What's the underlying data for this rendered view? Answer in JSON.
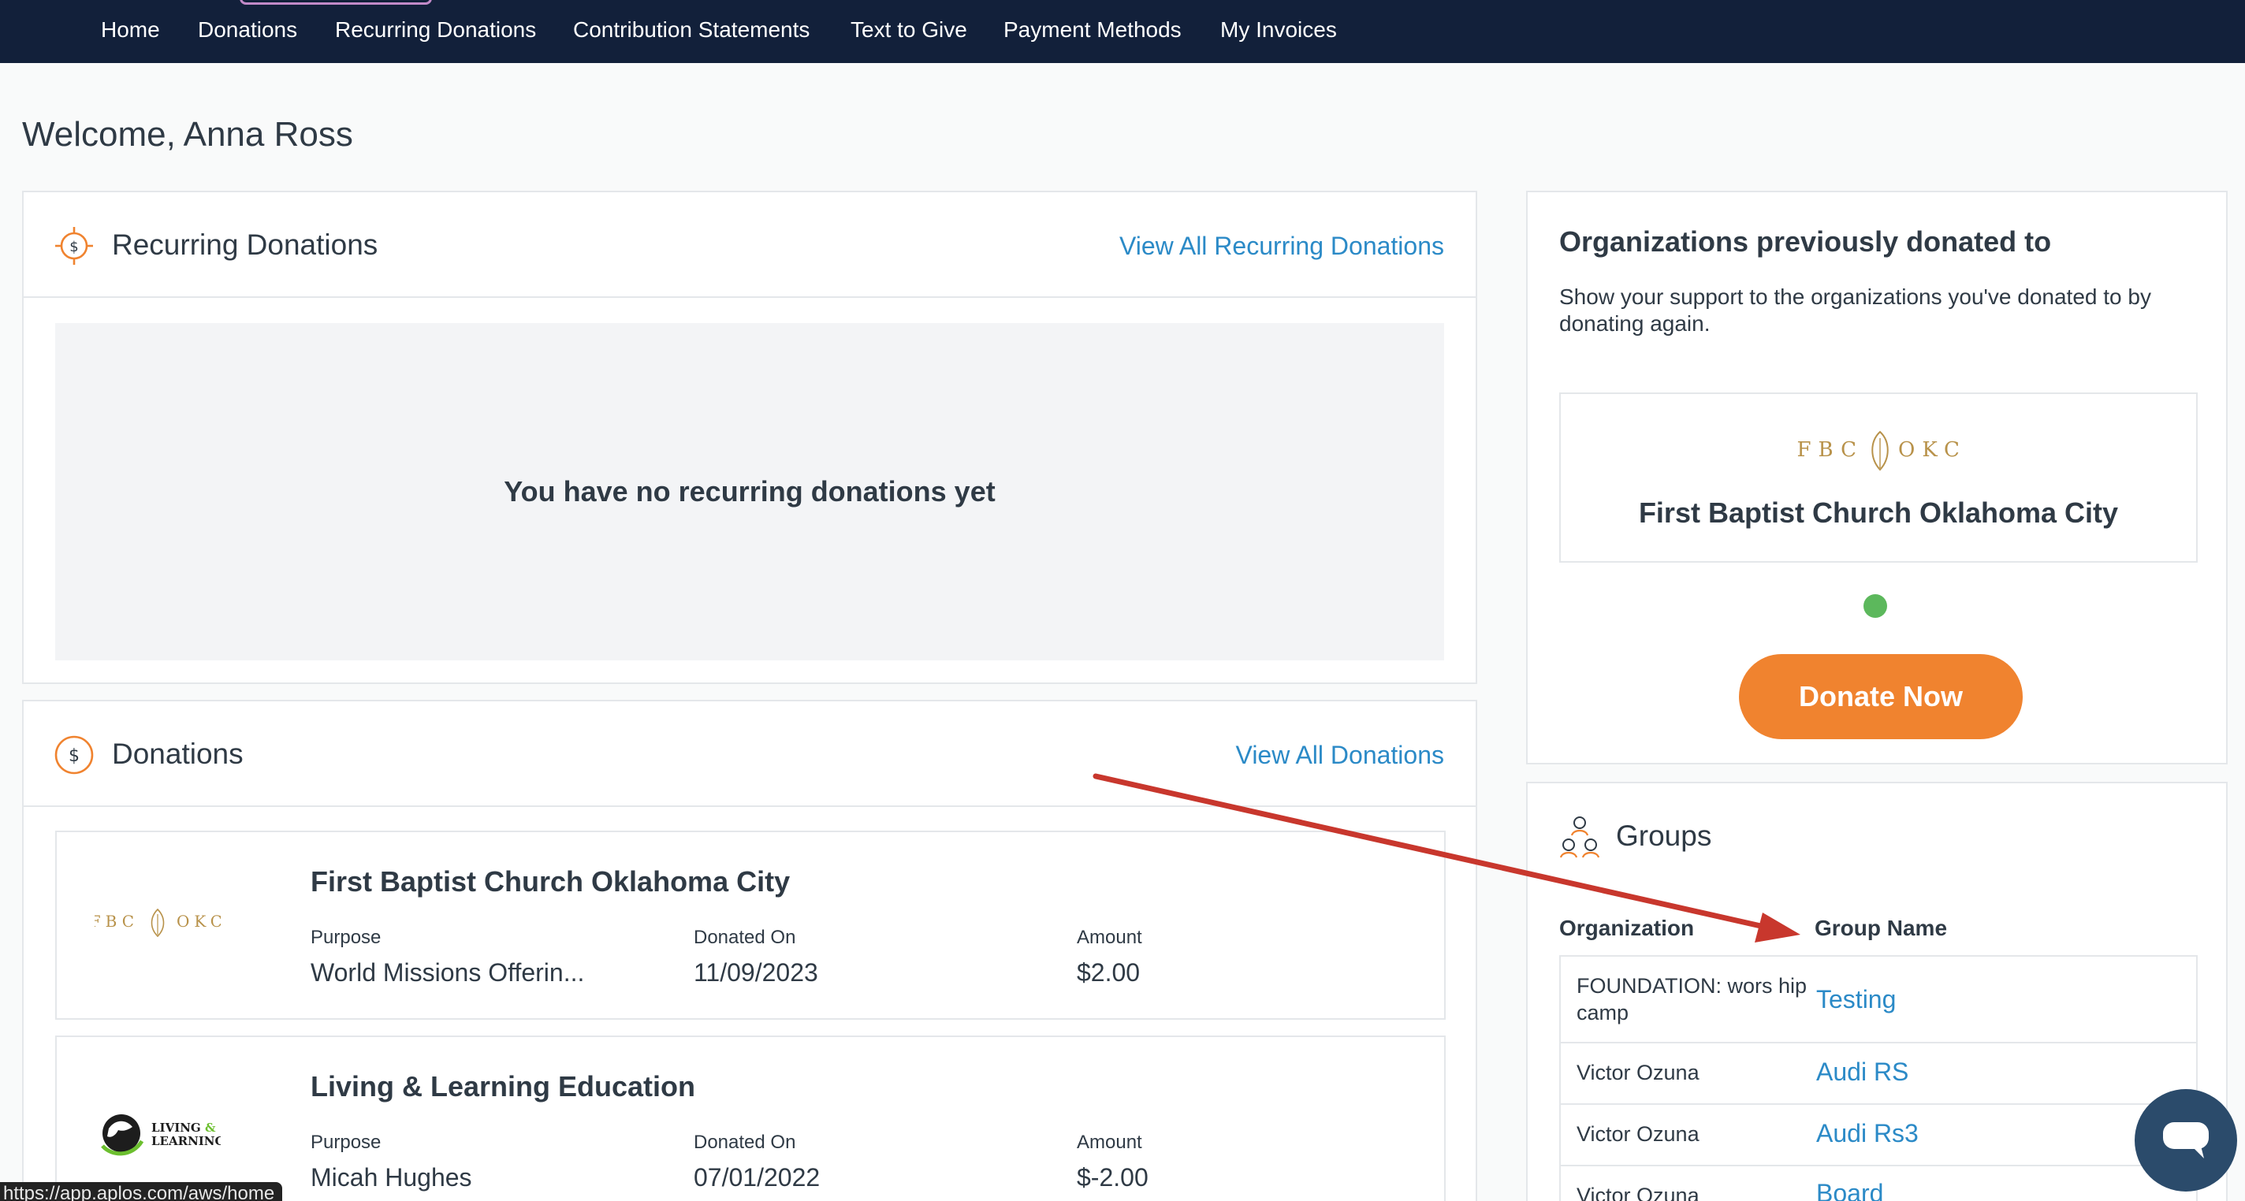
{
  "nav": {
    "items": [
      "Home",
      "Donations",
      "Recurring Donations",
      "Contribution Statements",
      "Text to Give",
      "Payment Methods",
      "My Invoices"
    ]
  },
  "welcome": "Welcome, Anna Ross",
  "recurring": {
    "title": "Recurring Donations",
    "link": "View All Recurring Donations",
    "empty_message": "You have no recurring donations yet"
  },
  "donations": {
    "title": "Donations",
    "link": "View All Donations",
    "items": [
      {
        "org": "First Baptist Church Oklahoma City",
        "purpose_label": "Purpose",
        "purpose": "World Missions Offerin...",
        "date_label": "Donated On",
        "date": "11/09/2023",
        "amount_label": "Amount",
        "amount": "$2.00"
      },
      {
        "org": "Living & Learning Education",
        "purpose_label": "Purpose",
        "purpose": "Micah Hughes",
        "date_label": "Donated On",
        "date": "07/01/2022",
        "amount_label": "Amount",
        "amount": "$-2.00"
      }
    ]
  },
  "logos": {
    "fbcokc_left": "FBC",
    "fbcokc_right": "OKC",
    "living_line1": "LIVING",
    "living_amp": "&",
    "living_line2": "LEARNING"
  },
  "orgs": {
    "title": "Organizations previously donated to",
    "description": "Show your support to the organizations you've donated to by donating again.",
    "tile_name": "First Baptist Church Oklahoma City",
    "donate_button": "Donate Now",
    "dot_color": "#5cb85c"
  },
  "groups": {
    "title": "Groups",
    "col_org": "Organization",
    "col_name": "Group Name",
    "rows": [
      {
        "org": "FOUNDATION: wors hip camp",
        "name": "Testing"
      },
      {
        "org": "Victor Ozuna",
        "name": "Audi RS"
      },
      {
        "org": "Victor Ozuna",
        "name": "Audi Rs3"
      },
      {
        "org": "Victor Ozuna",
        "name": "Board"
      }
    ]
  },
  "status_url": "https://app.aplos.com/aws/home",
  "colors": {
    "nav_bg": "#12203a",
    "accent_orange": "#f0832f",
    "link_blue": "#2b8ac7",
    "annotation_red": "#c8372d",
    "chat_bg": "#2b4b6b"
  },
  "icons": [
    "recurring-dollar-icon",
    "dollar-circle-icon",
    "groups-people-icon",
    "chat-bubble-icon",
    "annotation-arrow"
  ]
}
